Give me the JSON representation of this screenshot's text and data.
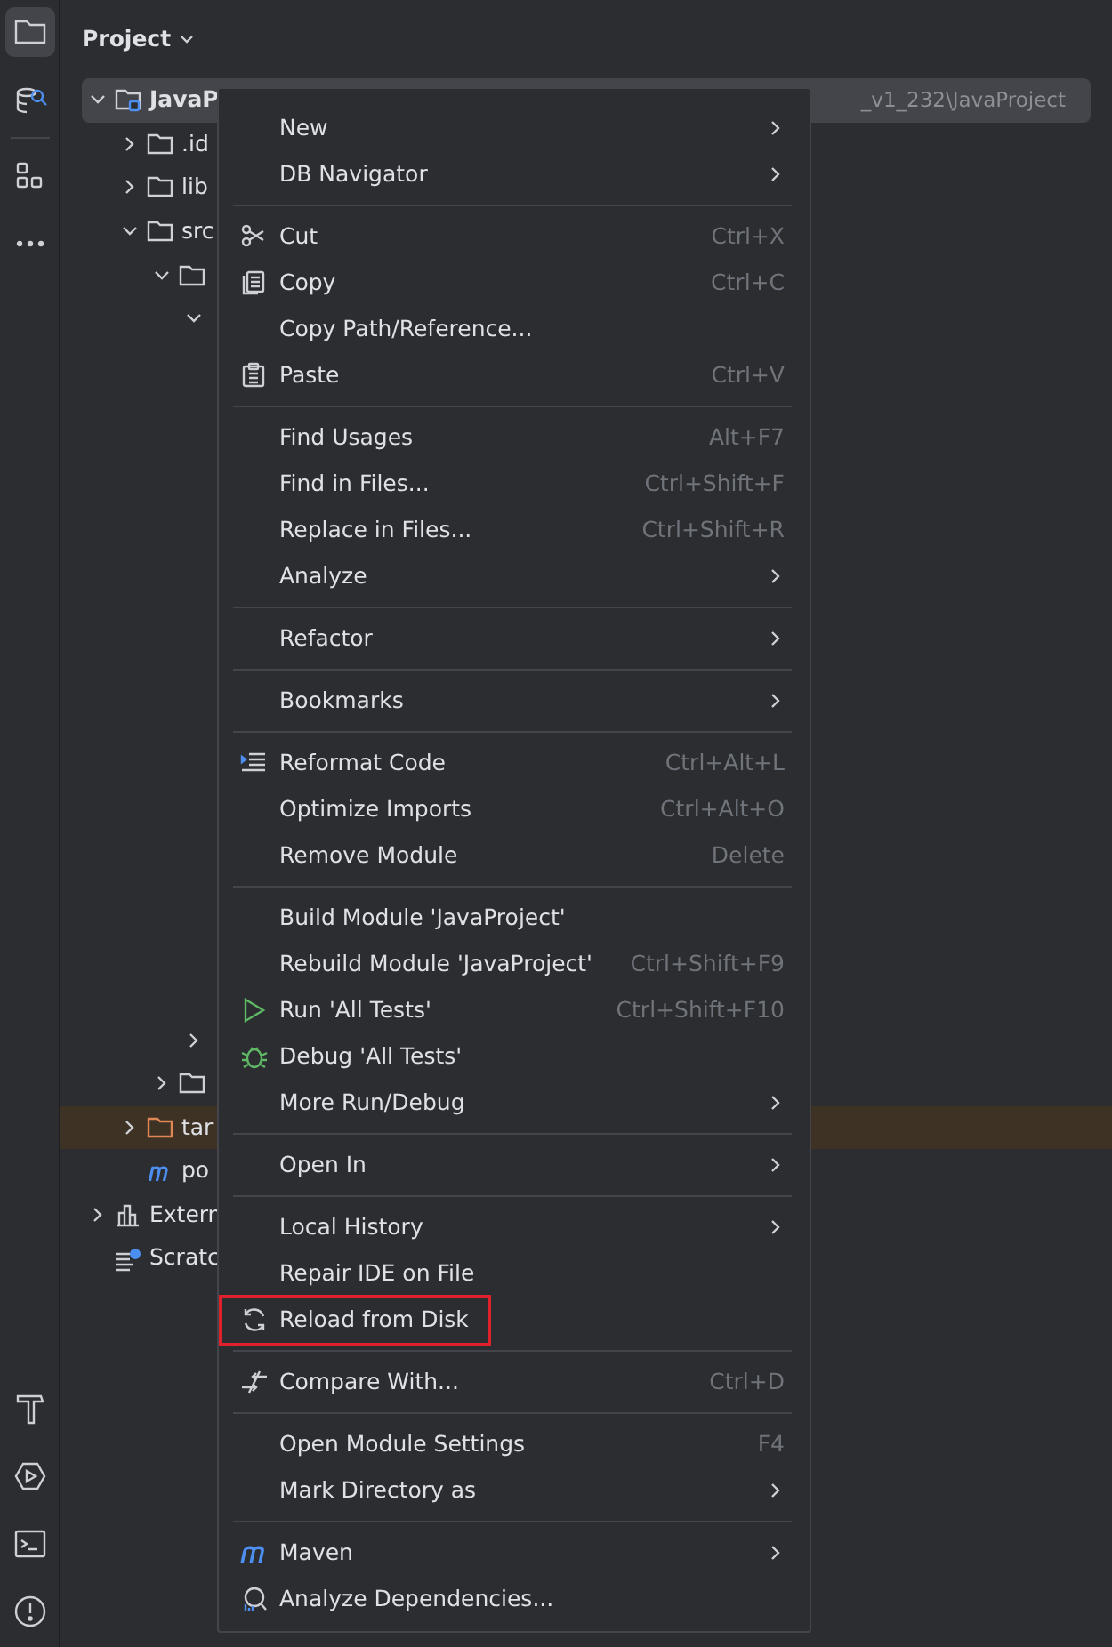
{
  "toolbar": {
    "top": [
      {
        "kind": "folder",
        "selected": true
      },
      {
        "kind": "database",
        "selected": false
      },
      {
        "kind": "structure",
        "selected": false
      },
      {
        "kind": "more",
        "selected": false
      }
    ],
    "bottom": [
      {
        "kind": "build",
        "selected": false
      },
      {
        "kind": "services",
        "selected": false
      },
      {
        "kind": "terminal",
        "selected": false
      },
      {
        "kind": "problems",
        "selected": false
      }
    ]
  },
  "panel": {
    "title": "Project"
  },
  "tree": [
    {
      "kind": "module",
      "label": "JavaP",
      "path": "_v1_232\\JavaProject",
      "expanded": true,
      "selected": true,
      "children": [
        {
          "kind": "folder",
          "label": ".id",
          "expanded": false,
          "selected": false
        },
        {
          "kind": "folder",
          "label": "lib",
          "expanded": false,
          "selected": false
        },
        {
          "kind": "folder",
          "label": "src",
          "expanded": true,
          "selected": false,
          "children": [
            {
              "kind": "folder",
              "expanded": true,
              "selected": false,
              "children": [
                {
                  "kind": "covered",
                  "expanded": true,
                  "selected": false
                },
                {
                  "kind": "covered",
                  "expanded": false,
                  "selected": false
                }
              ]
            },
            {
              "kind": "folder",
              "expanded": false,
              "selected": false
            }
          ]
        },
        {
          "kind": "excluded",
          "label": "tar",
          "expanded": false,
          "selected": false
        },
        {
          "kind": "maven",
          "label": "po",
          "selected": false
        }
      ]
    },
    {
      "kind": "libraries",
      "label": "Extern",
      "expanded": false,
      "selected": false
    },
    {
      "kind": "scratches",
      "label": "Scratc",
      "selected": false
    }
  ],
  "context_menu": {
    "groups": [
      [
        {
          "label": "New",
          "submenu": true
        },
        {
          "label": "DB Navigator",
          "submenu": true
        }
      ],
      [
        {
          "kind": "cut",
          "label": "Cut",
          "shortcut": "Ctrl+X"
        },
        {
          "kind": "copy",
          "label": "Copy",
          "shortcut": "Ctrl+C"
        },
        {
          "label": "Copy Path/Reference..."
        },
        {
          "kind": "paste",
          "label": "Paste",
          "shortcut": "Ctrl+V"
        }
      ],
      [
        {
          "label": "Find Usages",
          "shortcut": "Alt+F7"
        },
        {
          "label": "Find in Files...",
          "shortcut": "Ctrl+Shift+F"
        },
        {
          "label": "Replace in Files...",
          "shortcut": "Ctrl+Shift+R"
        },
        {
          "label": "Analyze",
          "submenu": true
        }
      ],
      [
        {
          "label": "Refactor",
          "submenu": true
        }
      ],
      [
        {
          "label": "Bookmarks",
          "submenu": true
        }
      ],
      [
        {
          "kind": "reformat",
          "label": "Reformat Code",
          "shortcut": "Ctrl+Alt+L"
        },
        {
          "label": "Optimize Imports",
          "shortcut": "Ctrl+Alt+O"
        },
        {
          "label": "Remove Module",
          "shortcut": "Delete"
        }
      ],
      [
        {
          "label": "Build Module 'JavaProject'"
        },
        {
          "label": "Rebuild Module 'JavaProject'",
          "shortcut": "Ctrl+Shift+F9"
        },
        {
          "kind": "run",
          "label": "Run 'All Tests'",
          "shortcut": "Ctrl+Shift+F10"
        },
        {
          "kind": "debug",
          "label": "Debug 'All Tests'"
        },
        {
          "label": "More Run/Debug",
          "submenu": true
        }
      ],
      [
        {
          "label": "Open In",
          "submenu": true
        }
      ],
      [
        {
          "label": "Local History",
          "submenu": true
        },
        {
          "label": "Repair IDE on File"
        },
        {
          "kind": "reload",
          "label": "Reload from Disk",
          "outlined": true
        }
      ],
      [
        {
          "kind": "compare",
          "label": "Compare With...",
          "shortcut": "Ctrl+D"
        }
      ],
      [
        {
          "label": "Open Module Settings",
          "shortcut": "F4"
        },
        {
          "label": "Mark Directory as",
          "submenu": true
        }
      ],
      [
        {
          "kind": "maven",
          "label": "Maven",
          "submenu": true
        },
        {
          "kind": "dependencies",
          "label": "Analyze Dependencies..."
        }
      ]
    ]
  }
}
